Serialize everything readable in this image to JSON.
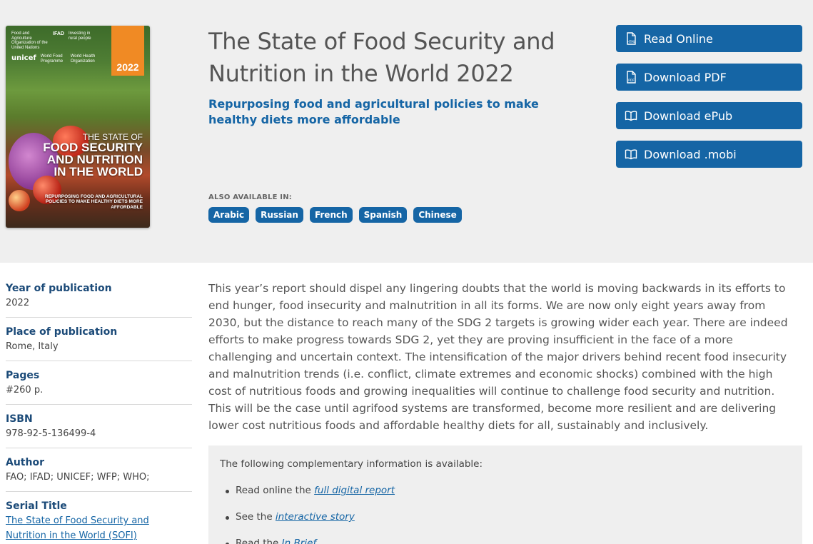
{
  "cover": {
    "year": "2022",
    "title_line1": "THE STATE OF",
    "title_line2": "FOOD SECURITY",
    "title_line3": "AND NUTRITION",
    "title_line4": "IN THE WORLD",
    "subtitle": "REPURPOSING FOOD AND AGRICULTURAL POLICIES TO MAKE HEALTHY DIETS MORE AFFORDABLE",
    "logo_unicef": "unicef",
    "logo_ifad": "IFAD",
    "logo_fao": "Food and Agriculture Organization of the United Nations",
    "logo_wfp": "World Food Programme",
    "logo_who": "World Health Organization",
    "logo_ifad_sub": "Investing in rural people"
  },
  "publication": {
    "title": "The State of Food Security and Nutrition in the World 2022",
    "subtitle": "Repurposing food and agricultural policies to make healthy diets more affordable"
  },
  "languages": {
    "label": "ALSO AVAILABLE IN:",
    "items": [
      "Arabic",
      "Russian",
      "French",
      "Spanish",
      "Chinese"
    ]
  },
  "actions": [
    {
      "label": "Read Online",
      "icon": "html-file-icon"
    },
    {
      "label": "Download PDF",
      "icon": "pdf-file-icon"
    },
    {
      "label": "Download ePub",
      "icon": "book-icon"
    },
    {
      "label": "Download .mobi",
      "icon": "book-icon"
    }
  ],
  "meta": {
    "year_label": "Year of publication",
    "year_value": "2022",
    "place_label": "Place of publication",
    "place_value": "Rome, Italy",
    "pages_label": "Pages",
    "pages_value": "#260 p.",
    "isbn_label": "ISBN",
    "isbn_value": "978-92-5-136499-4",
    "author_label": "Author",
    "author_value": "FAO; IFAD; UNICEF; WFP; WHO;",
    "serial_label": "Serial Title",
    "serial_value": "The State of Food Security and Nutrition in the World (SOFI)"
  },
  "description": "This year’s report should dispel any lingering doubts that the world is moving backwards in its efforts to end hunger, food insecurity and malnutrition in all its forms. We are now only eight years away from 2030, but the distance to reach many of the SDG 2 targets is growing wider each year. There are indeed efforts to make progress towards SDG 2, yet they are proving insufficient in the face of a more challenging and uncertain context. The intensification of the major drivers behind recent food insecurity and malnutrition trends (i.e. conflict, climate extremes and economic shocks) combined with the high cost of nutritious foods and growing inequalities will continue to challenge food security and nutrition. This will be the case until agrifood systems are transformed, become more resilient and are delivering lower cost nutritious foods and affordable healthy diets for all, sustainably and inclusively.",
  "info": {
    "intro": "The following complementary information is available:",
    "items": [
      {
        "prefix": "Read online the ",
        "link": "full digital report"
      },
      {
        "prefix": "See the ",
        "link": "interactive story"
      },
      {
        "prefix": "Read the ",
        "link": "In Brief"
      }
    ]
  }
}
